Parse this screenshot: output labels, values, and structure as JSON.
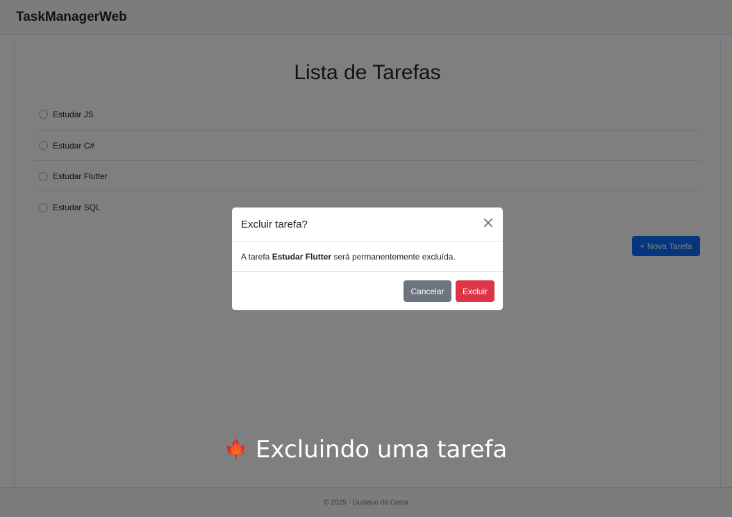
{
  "navbar": {
    "brand": "TaskManagerWeb"
  },
  "page": {
    "title": "Lista de Tarefas"
  },
  "tasks": [
    {
      "label": "Estudar JS"
    },
    {
      "label": "Estudar C#"
    },
    {
      "label": "Estudar Flutter"
    },
    {
      "label": "Estudar SQL"
    }
  ],
  "actions": {
    "new_task_label": "+ Nova Tarefa"
  },
  "footer": {
    "text": "© 2025 - Gustavo da Costa"
  },
  "modal": {
    "title": "Excluir tarefa?",
    "close_symbol": "×",
    "body_prefix": "A tarefa ",
    "task_name": "Estudar Flutter",
    "body_suffix": " será permanentemente excluída.",
    "cancel_label": "Cancelar",
    "delete_label": "Excluir"
  },
  "caption": {
    "icon": "maple-leaf-icon",
    "icon_glyph": "🍁",
    "text": "Excluindo uma tarefa"
  },
  "colors": {
    "primary": "#0d6efd",
    "secondary": "#6c757d",
    "danger": "#dc3545"
  }
}
